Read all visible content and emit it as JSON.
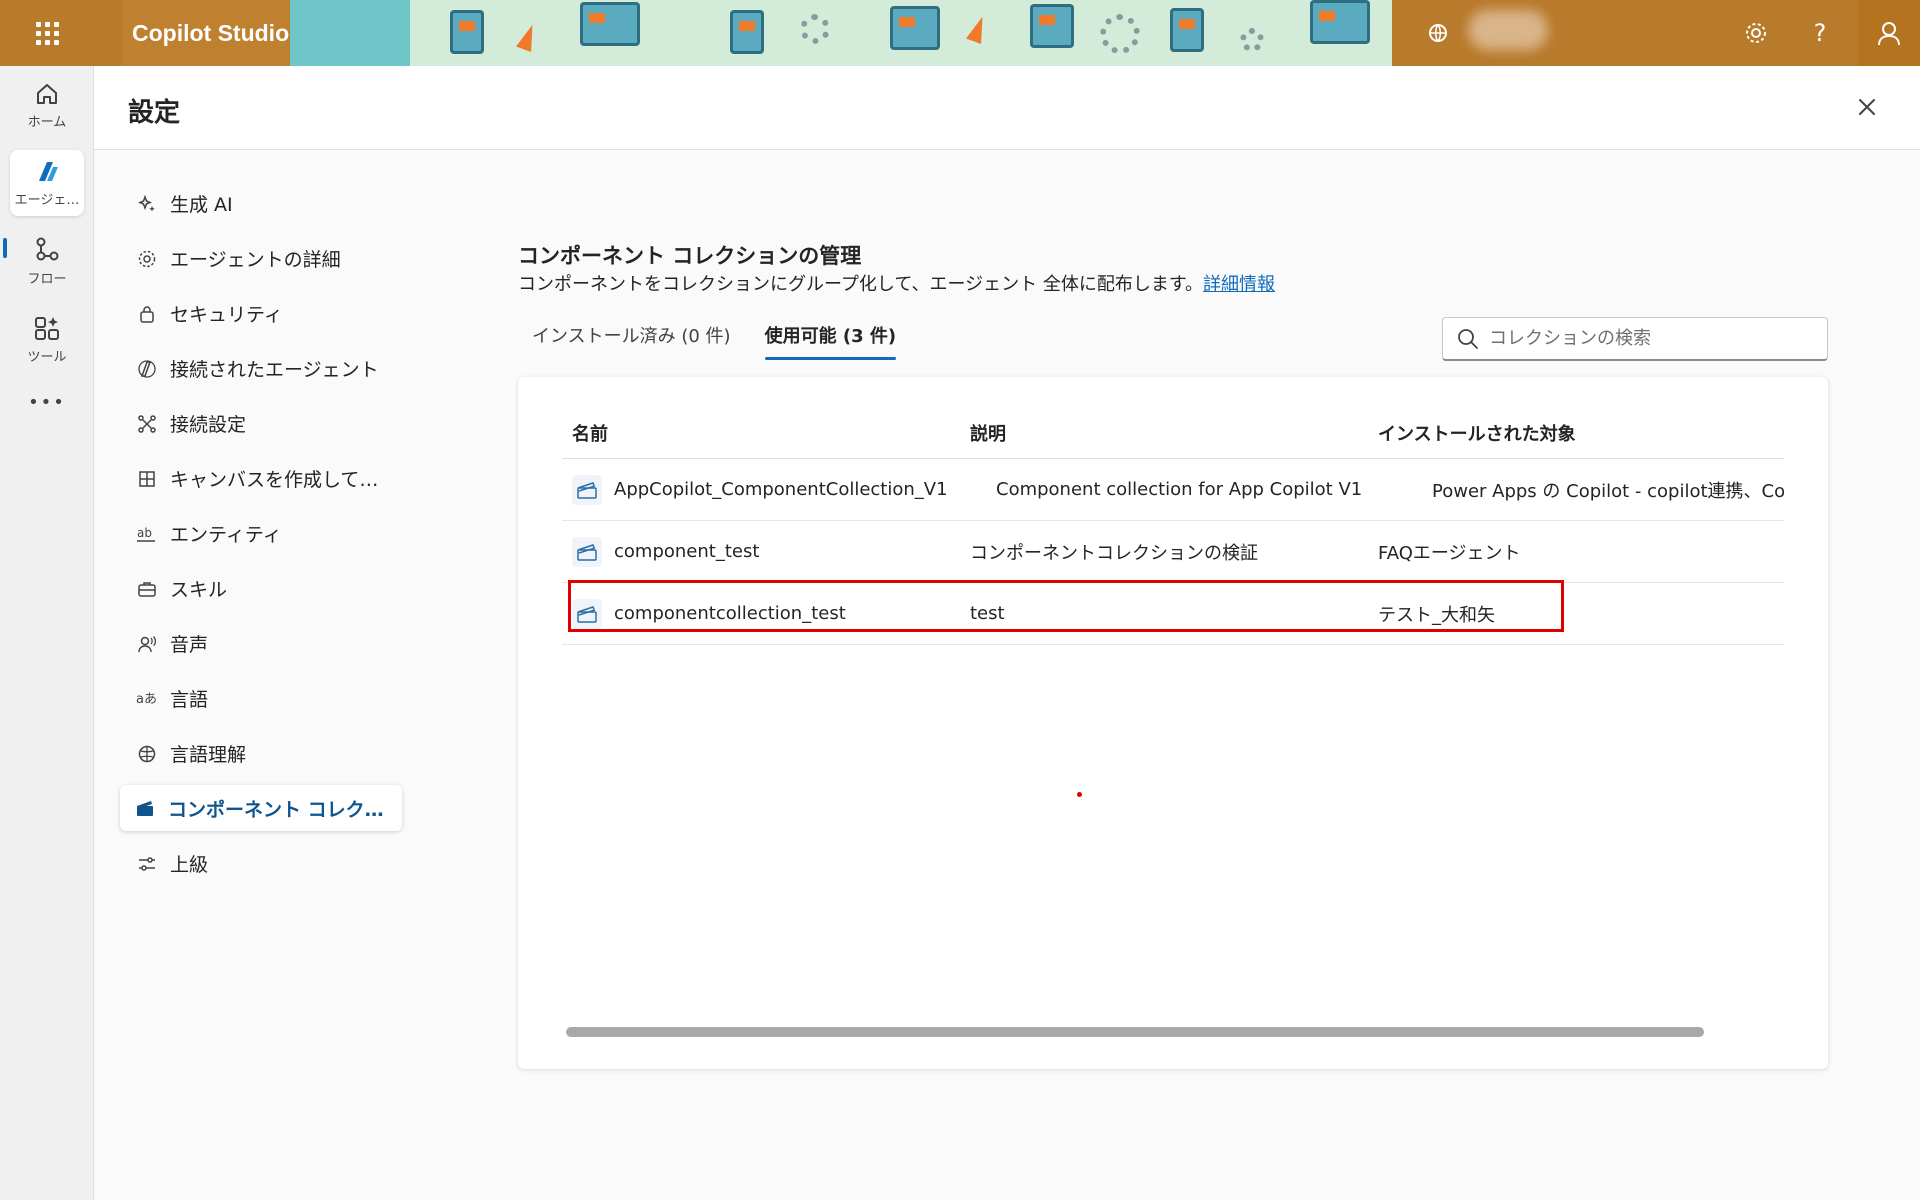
{
  "app": {
    "title": "Copilot Studio",
    "accent": "#0f6cbd",
    "banner_color": "#b87a2b"
  },
  "topbar": {
    "waffle_icon": "waffle-icon",
    "settings_icon": "gear-icon",
    "help_label": "?",
    "account_icon": "person-icon"
  },
  "rail": {
    "items": [
      {
        "label": "ホーム",
        "icon": "home-icon"
      },
      {
        "label": "エージェ…",
        "icon": "agent-icon"
      },
      {
        "label": "フロー",
        "icon": "flow-icon"
      },
      {
        "label": "ツール",
        "icon": "tools-icon"
      }
    ],
    "more_label": "•••"
  },
  "page": {
    "title": "設定"
  },
  "nav": {
    "items": [
      {
        "label": "生成 AI",
        "icon": "sparkle-icon"
      },
      {
        "label": "エージェントの詳細",
        "icon": "gear-icon"
      },
      {
        "label": "セキュリティ",
        "icon": "lock-icon"
      },
      {
        "label": "接続されたエージェント",
        "icon": "connected-agent-icon"
      },
      {
        "label": "接続設定",
        "icon": "connection-icon"
      },
      {
        "label": "キャンバスを作成して…",
        "icon": "grid-icon"
      },
      {
        "label": "エンティティ",
        "icon": "entity-icon"
      },
      {
        "label": "スキル",
        "icon": "briefcase-icon"
      },
      {
        "label": "音声",
        "icon": "voice-icon"
      },
      {
        "label": "言語",
        "icon": "language-icon"
      },
      {
        "label": "言語理解",
        "icon": "brain-icon"
      },
      {
        "label": "コンポーネント コレク…",
        "icon": "clapperboard-icon"
      },
      {
        "label": "上級",
        "icon": "sliders-icon"
      }
    ],
    "active_index": 11
  },
  "content": {
    "title": "コンポーネント コレクションの管理",
    "description": "コンポーネントをコレクションにグループ化して、エージェント 全体に配布します。",
    "learn_more": "詳細情報",
    "tabs": [
      {
        "label": "インストール済み (0 件)"
      },
      {
        "label": "使用可能 (3 件)"
      }
    ],
    "search_placeholder": "コレクションの検索",
    "table": {
      "columns": [
        "名前",
        "説明",
        "インストールされた対象"
      ],
      "rows": [
        {
          "name": "AppCopilot_ComponentCollection_V1",
          "description": "Component collection for App Copilot V1",
          "installed_to": "Power Apps の Copilot - copilot連携、Co"
        },
        {
          "name": "component_test",
          "description": "コンポーネントコレクションの検証",
          "installed_to": "FAQエージェント"
        },
        {
          "name": "componentcollection_test",
          "description": "test",
          "installed_to": "テスト_大和矢"
        }
      ]
    }
  }
}
